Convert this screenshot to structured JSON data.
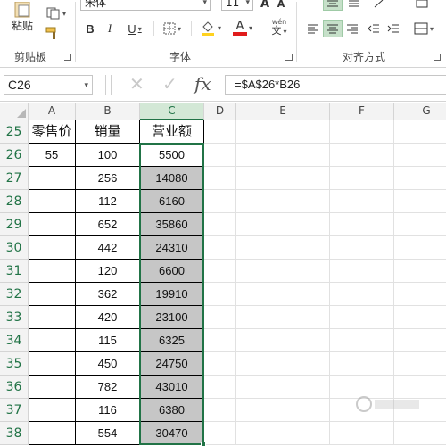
{
  "ribbon": {
    "paste_label": "粘贴",
    "clipboard_label": "剪贴板",
    "font_group_label": "字体",
    "align_group_label": "对齐方式",
    "font_name": "宋体",
    "font_size": "11",
    "bold": "B",
    "italic": "I",
    "underline": "U",
    "grow_font": "A",
    "shrink_font": "A",
    "font_color_glyph": "A",
    "phonetic_glyph": "wén"
  },
  "formula_bar": {
    "name_box": "C26",
    "cancel_glyph": "✕",
    "enter_glyph": "✓",
    "fx_glyph": "fx",
    "formula": "=$A$26*B26"
  },
  "columns": [
    "A",
    "B",
    "C",
    "D",
    "E",
    "F",
    "G"
  ],
  "rows": [
    {
      "num": "25",
      "a": "零售价",
      "b": "销量",
      "c": "营业额"
    },
    {
      "num": "26",
      "a": "55",
      "b": "100",
      "c": "5500"
    },
    {
      "num": "27",
      "a": "",
      "b": "256",
      "c": "14080"
    },
    {
      "num": "28",
      "a": "",
      "b": "112",
      "c": "6160"
    },
    {
      "num": "29",
      "a": "",
      "b": "652",
      "c": "35860"
    },
    {
      "num": "30",
      "a": "",
      "b": "442",
      "c": "24310"
    },
    {
      "num": "31",
      "a": "",
      "b": "120",
      "c": "6600"
    },
    {
      "num": "32",
      "a": "",
      "b": "362",
      "c": "19910"
    },
    {
      "num": "33",
      "a": "",
      "b": "420",
      "c": "23100"
    },
    {
      "num": "34",
      "a": "",
      "b": "115",
      "c": "6325"
    },
    {
      "num": "35",
      "a": "",
      "b": "450",
      "c": "24750"
    },
    {
      "num": "36",
      "a": "",
      "b": "782",
      "c": "43010"
    },
    {
      "num": "37",
      "a": "",
      "b": "116",
      "c": "6380"
    },
    {
      "num": "38",
      "a": "",
      "b": "554",
      "c": "30470"
    }
  ],
  "colors": {
    "accent": "#217346",
    "selection_fill": "#c6c6c6",
    "header_fill": "#f3f3f3"
  }
}
